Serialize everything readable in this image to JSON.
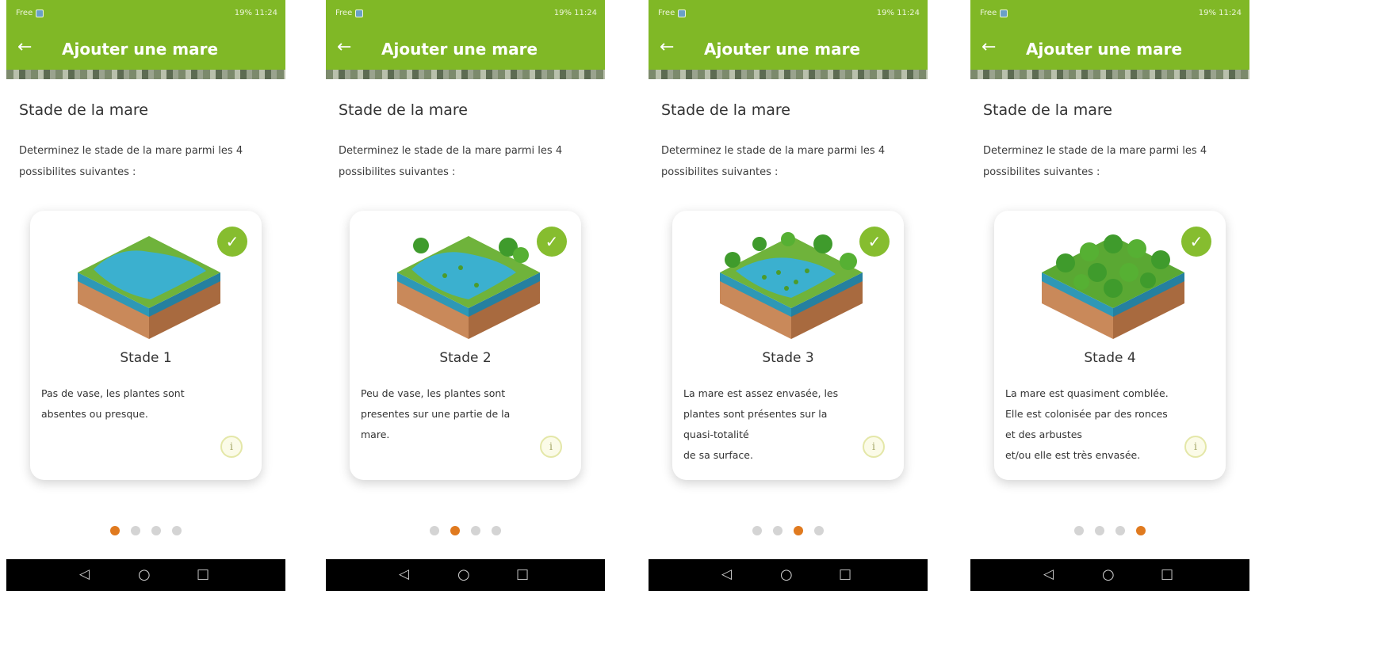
{
  "status_bar": {
    "left_text": "Free",
    "right_text": "19% 11:24"
  },
  "app_bar": {
    "title": "Ajouter une mare"
  },
  "section": {
    "title": "Stade de la mare",
    "description": "Determinez le stade de la mare parmi les 4 possibilites suivantes :"
  },
  "icons": {
    "back": "←",
    "check": "✓",
    "info": "i",
    "nav_back": "◁",
    "nav_home": "○",
    "nav_recent": "□"
  },
  "colors": {
    "header_green": "#80b826",
    "check_green": "#86bd2f",
    "active_dot": "#e07a1f",
    "inactive_dot": "#d4d4d4",
    "water": "#3bb0cf",
    "soil": "#c9895a"
  },
  "screens": [
    {
      "stage": "Stade 1",
      "description": "Pas de vase, les plantes sont\nabsentes ou presque.",
      "active_index": 0
    },
    {
      "stage": "Stade 2",
      "description": " Peu de vase, les plantes sont\npresentes sur une partie de la\nmare.",
      "active_index": 1
    },
    {
      "stage": "Stade 3",
      "description": "La mare est assez envasée, les\nplantes sont présentes sur la\nquasi-totalité\n de sa surface.",
      "active_index": 2
    },
    {
      "stage": "Stade 4",
      "description": "La mare est quasiment comblée.\nElle est colonisée par des ronces\net des arbustes\net/ou elle est très envasée.",
      "active_index": 3
    }
  ]
}
